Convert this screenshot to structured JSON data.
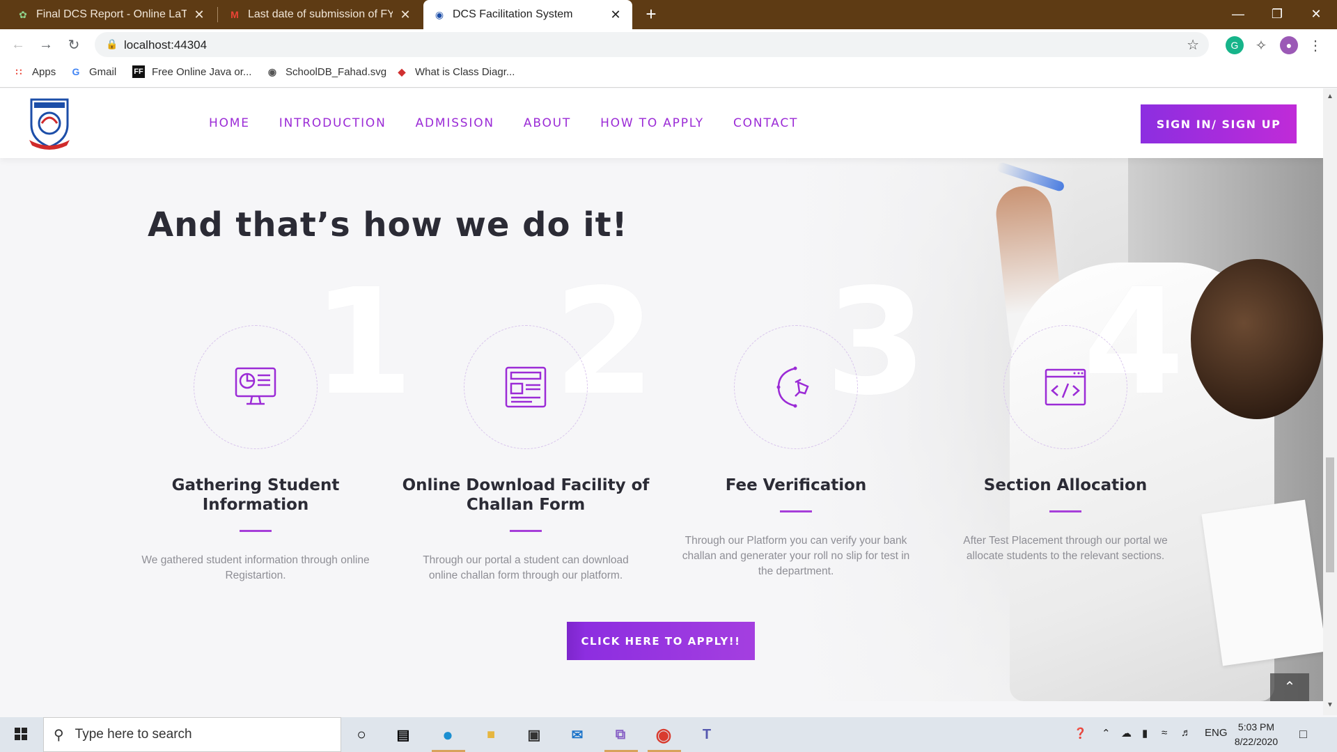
{
  "browser": {
    "tabs": [
      {
        "title": "Final DCS Report - Online LaTeX E",
        "active": false,
        "icon": "overleaf-icon"
      },
      {
        "title": "Last date of submission of FYP fo",
        "active": false,
        "icon": "gmail-icon"
      },
      {
        "title": "DCS Facilitation System",
        "active": true,
        "icon": "site-logo-icon"
      }
    ],
    "new_tab": "+",
    "url": "localhost:44304",
    "bookmarks": [
      {
        "label": "Apps",
        "icon": "apps-grid-icon"
      },
      {
        "label": "Gmail",
        "icon": "google-icon"
      },
      {
        "label": "Free Online Java or...",
        "icon": "ff-icon"
      },
      {
        "label": "SchoolDB_Fahad.svg",
        "icon": "globe-icon"
      },
      {
        "label": "What is Class Diagr...",
        "icon": "diamond-icon"
      }
    ]
  },
  "site": {
    "nav": [
      "HOME",
      "INTRODUCTION",
      "ADMISSION",
      "ABOUT",
      "HOW TO APPLY",
      "CONTACT"
    ],
    "signin_label": "SIGN IN/ SIGN UP",
    "headline": "And that’s how we do it!",
    "steps": [
      {
        "number": "1",
        "title": "Gathering Student Information",
        "desc": "We gathered student information through online Registartion.",
        "icon": "monitor-chart-icon"
      },
      {
        "number": "2",
        "title": "Online Download Facility of Challan Form",
        "desc": "Through our portal a student can download online challan form through our platform.",
        "icon": "document-form-icon"
      },
      {
        "number": "3",
        "title": "Fee Verification",
        "desc": "Through our Platform you can verify your bank challan and generater your roll no slip for test in the department.",
        "icon": "pen-tool-icon"
      },
      {
        "number": "4",
        "title": "Section Allocation",
        "desc": "After Test Placement through our portal we allocate students to the relevant sections.",
        "icon": "code-window-icon"
      }
    ],
    "apply_label": "CLICK HERE TO APPLY!!",
    "accent": "#9b2bd6"
  },
  "taskbar": {
    "search_placeholder": "Type here to search",
    "language": "ENG",
    "time": "5:03 PM",
    "date": "8/22/2020"
  }
}
